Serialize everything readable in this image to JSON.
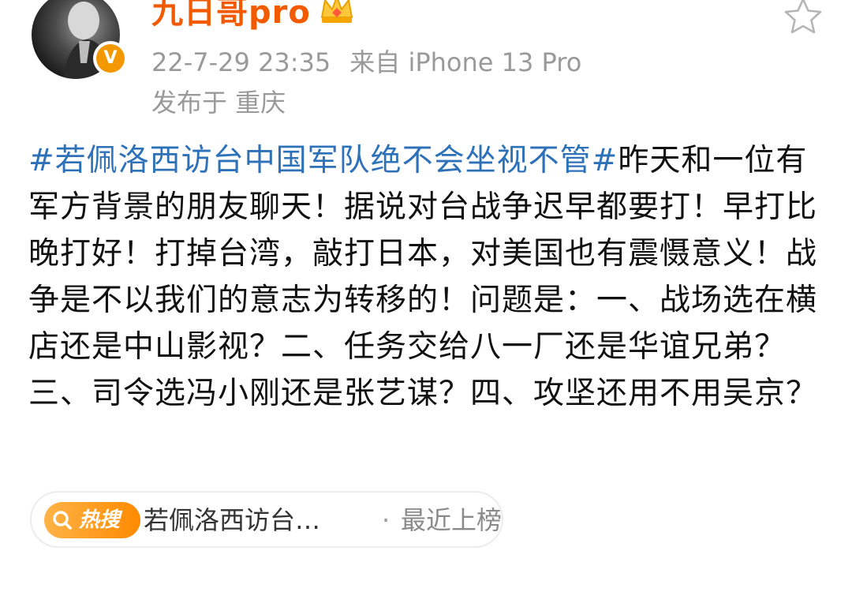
{
  "user": {
    "name": "九日哥pro",
    "verified_mark": "V",
    "avatar": "avatar-photo",
    "badge_icon": "crown-icon"
  },
  "meta": {
    "time": "22-7-29 23:35",
    "source": "来自 iPhone 13 Pro",
    "location": "发布于 重庆"
  },
  "actions": {
    "favorite_icon": "star-icon"
  },
  "post": {
    "topic": "#若佩洛西访台中国军队绝不会坐视不管#",
    "body": "昨天和一位有军方背景的朋友聊天！据说对台战争迟早都要打！早打比晚打好！打掉台湾，敲打日本，对美国也有震慑意义！战争是不以我们的意志为转移的！问题是：一、战场选在横店还是中山影视？二、任务交给八一厂还是华谊兄弟？三、司令选冯小刚还是张艺谋？四、攻坚还用不用吴京？"
  },
  "hot_search": {
    "badge_label": "热搜",
    "topic": "若佩洛西访台…",
    "separator": "·",
    "status": "最近上榜"
  },
  "colors": {
    "username": "#f25a00",
    "topic_link": "#2d71b8",
    "meta_gray": "#9a9a9a",
    "hot_orange": "#ff8a00"
  }
}
